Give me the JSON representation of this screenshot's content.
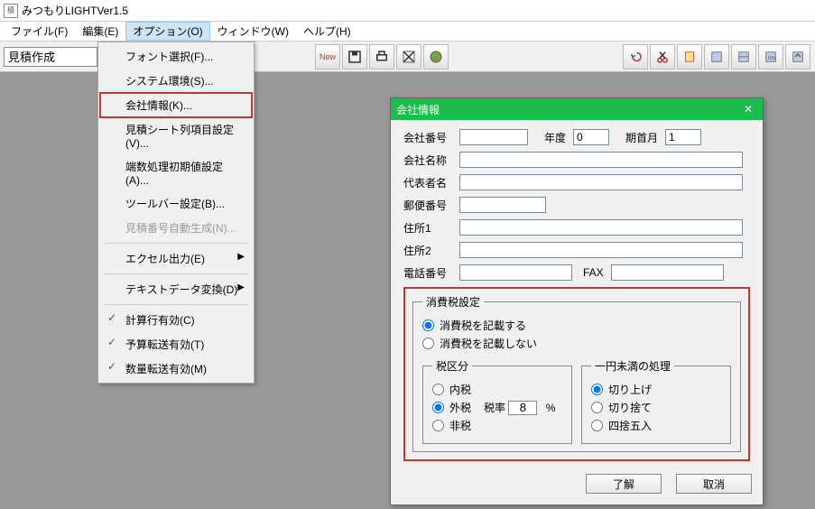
{
  "window": {
    "title": "みつもりLIGHTVer1.5"
  },
  "menubar": {
    "file": "ファイル(F)",
    "edit": "編集(E)",
    "option": "オプション(O)",
    "window": "ウィンドウ(W)",
    "help": "ヘルプ(H)"
  },
  "toolbar": {
    "mode_input": "見積作成"
  },
  "dropdown": {
    "font_select": "フォント選択(F)...",
    "sys_env": "システム環境(S)...",
    "company_info": "会社情報(K)...",
    "sheet_cols": "見積シート列項目設定(V)...",
    "fraction_init": "端数処理初期値設定(A)...",
    "toolbar_set": "ツールバー設定(B)...",
    "seq_gen": "見積番号自動生成(N)...",
    "excel_out": "エクセル出力(E)",
    "text_conv": "テキストデータ変換(D)",
    "calc_enabled": "計算行有効(C)",
    "budget_fwd": "予算転送有効(T)",
    "qty_fwd": "数量転送有効(M)"
  },
  "dialog": {
    "title": "会社情報",
    "labels": {
      "company_no": "会社番号",
      "year": "年度",
      "start_month": "期首月",
      "company_name": "会社名称",
      "rep_name": "代表者名",
      "postal": "郵便番号",
      "addr1": "住所1",
      "addr2": "住所2",
      "tel": "電話番号",
      "fax": "FAX"
    },
    "values": {
      "company_no": "",
      "year": "0",
      "start_month": "1",
      "company_name": "",
      "rep_name": "",
      "postal": "",
      "addr1": "",
      "addr2": "",
      "tel": "",
      "fax": ""
    },
    "tax": {
      "legend": "消費税設定",
      "record_yes": "消費税を記載する",
      "record_no": "消費税を記載しない",
      "cat_legend": "税区分",
      "cat_inner": "内税",
      "cat_outer": "外税",
      "cat_none": "非税",
      "rate_label": "税率",
      "rate_value": "8",
      "rate_unit": "%",
      "round_legend": "一円未満の処理",
      "round_up": "切り上げ",
      "round_down": "切り捨て",
      "round_half": "四捨五入"
    },
    "buttons": {
      "ok": "了解",
      "cancel": "取消"
    }
  }
}
